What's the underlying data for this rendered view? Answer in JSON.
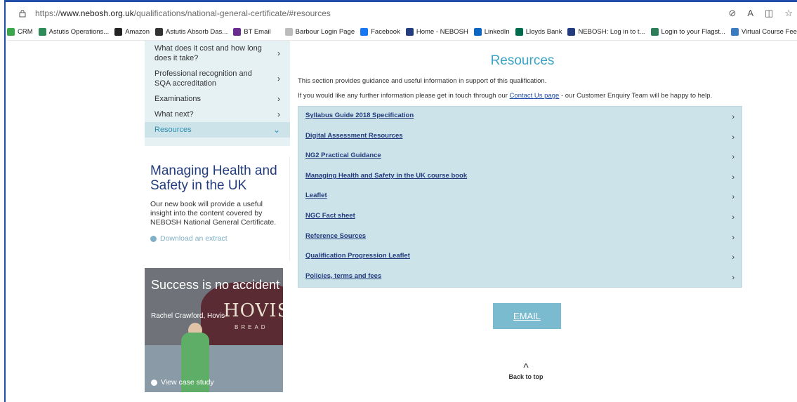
{
  "browser": {
    "url_prefix": "https://",
    "url_host": "www.nebosh.org.uk",
    "url_path": "/qualifications/national-general-certificate/#resources",
    "bookmarks": [
      {
        "label": "CRM",
        "color": "#3aa74a"
      },
      {
        "label": "Astutis Operations...",
        "color": "#2e8b57"
      },
      {
        "label": "Amazon",
        "color": "#222222"
      },
      {
        "label": "Astutis  Absorb Das...",
        "color": "#333333"
      },
      {
        "label": "BT Email",
        "color": "#6a2c8f"
      },
      {
        "label": "Barbour Login Page",
        "color": "#bbbbbb"
      },
      {
        "label": "Facebook",
        "color": "#1877f2"
      },
      {
        "label": "Home - NEBOSH",
        "color": "#233c7d"
      },
      {
        "label": "LinkedIn",
        "color": "#0a66c2"
      },
      {
        "label": "Lloyds Bank",
        "color": "#006a4d"
      },
      {
        "label": "NEBOSH: Log in to t...",
        "color": "#233c7d"
      },
      {
        "label": "Login to your Flagst...",
        "color": "#2d7d5a"
      },
      {
        "label": "Virtual Course Feed...",
        "color": "#3b7bbf"
      }
    ]
  },
  "nav": {
    "items": [
      {
        "label": "What does it cost and how long does it take?"
      },
      {
        "label": "Professional recognition and SQA accreditation"
      },
      {
        "label": "Examinations"
      },
      {
        "label": "What next?"
      },
      {
        "label": "Resources"
      }
    ]
  },
  "promo": {
    "title": "Managing Health and Safety in the UK",
    "text": "Our new book will provide a useful insight into the content covered by NEBOSH National General Certificate.",
    "link": "Download an extract"
  },
  "case_study": {
    "title": "Success is no accident",
    "subtitle": "Rachel Crawford, Hovis",
    "brand": "HOVIS",
    "brand_sub": "BREAD",
    "link": "View case study"
  },
  "main": {
    "title": "Resources",
    "intro": "This section provides guidance and useful information in support of this qualification.",
    "contact_pre": "If you would like any further information please get in touch through our ",
    "contact_link": "Contact Us page",
    "contact_post": " - our Customer Enquiry Team will be happy to help.",
    "resources": [
      {
        "label": "Syllabus Guide 2018 Specification"
      },
      {
        "label": "Digital Assessment Resources"
      },
      {
        "label": "NG2 Practical Guidance"
      },
      {
        "label": "Managing Health and Safety in the UK course book"
      },
      {
        "label": "Leaflet"
      },
      {
        "label": "NGC Fact sheet"
      },
      {
        "label": "Reference Sources"
      },
      {
        "label": "Qualification Progression Leaflet"
      },
      {
        "label": "Policies, terms and fees"
      }
    ],
    "email_button": "EMAIL",
    "back_to_top": "Back to top"
  }
}
